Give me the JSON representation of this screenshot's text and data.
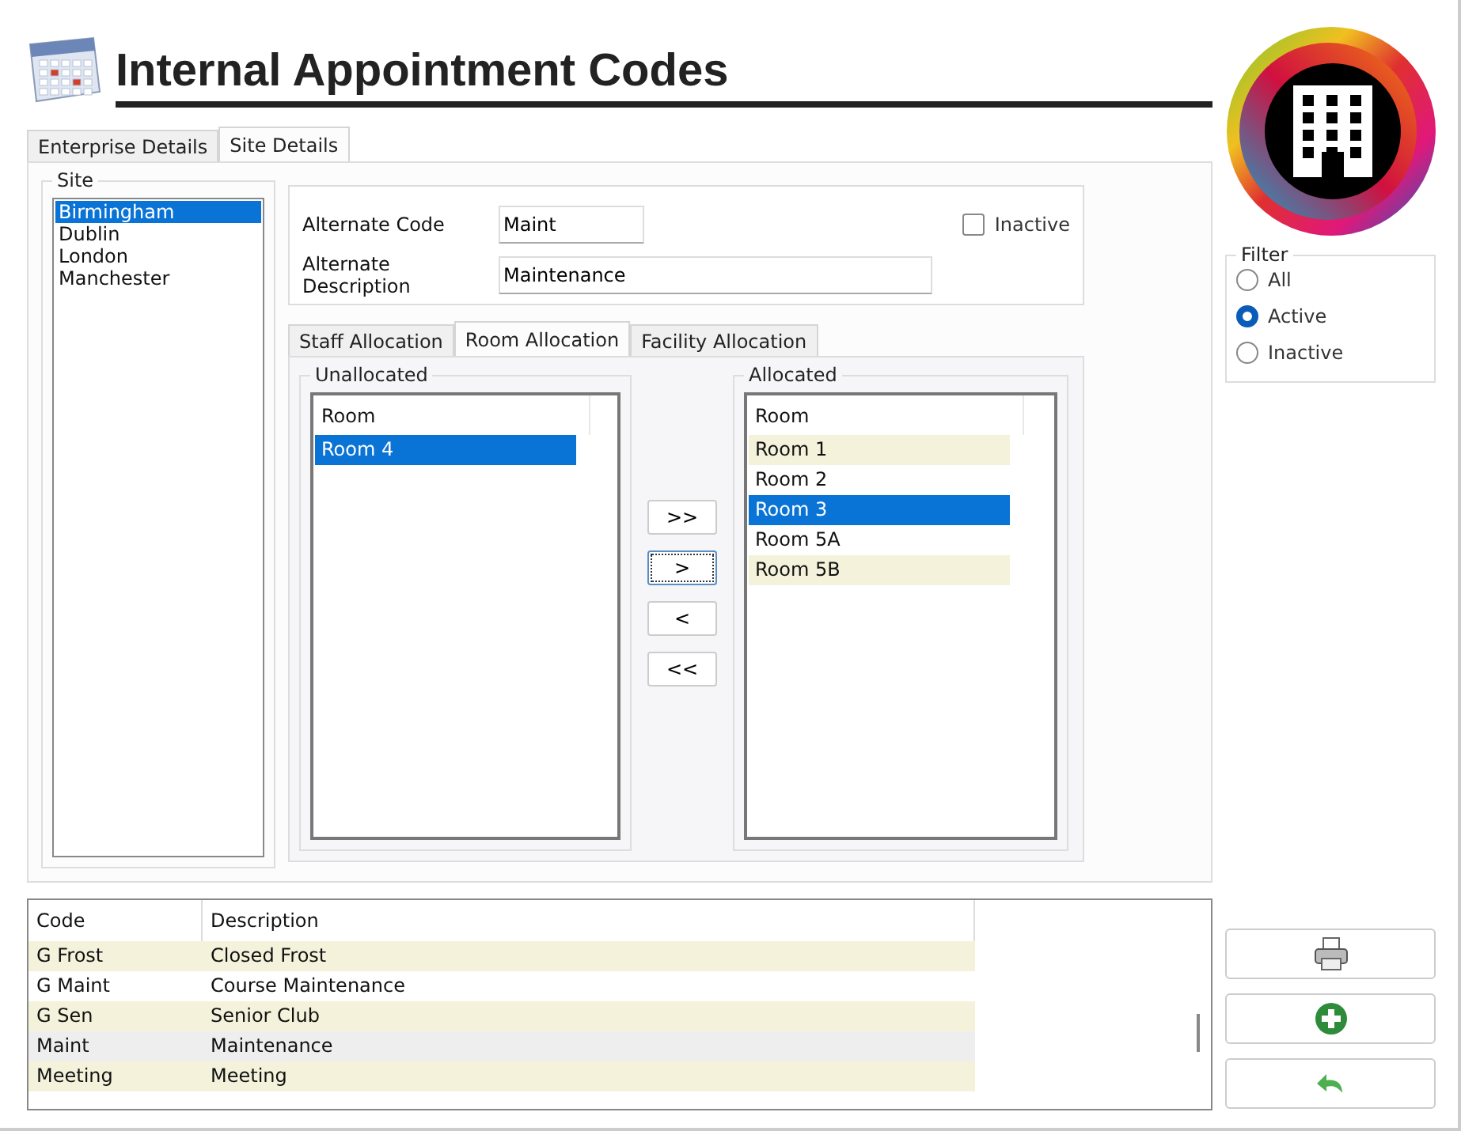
{
  "title": "Internal Appointment Codes",
  "tabs": [
    {
      "label": "Enterprise Details",
      "selected": false
    },
    {
      "label": "Site Details",
      "selected": true
    }
  ],
  "site": {
    "legend": "Site",
    "items": [
      {
        "label": "Birmingham",
        "selected": true
      },
      {
        "label": "Dublin",
        "selected": false
      },
      {
        "label": "London",
        "selected": false
      },
      {
        "label": "Manchester",
        "selected": false
      }
    ]
  },
  "alternate_code": {
    "label": "Alternate Code",
    "value": "Maint"
  },
  "alternate_description": {
    "label": "Alternate Description",
    "value": "Maintenance"
  },
  "inactive": {
    "label": "Inactive",
    "checked": false
  },
  "allocation_tabs": [
    {
      "label": "Staff Allocation",
      "selected": false
    },
    {
      "label": "Room Allocation",
      "selected": true
    },
    {
      "label": "Facility Allocation",
      "selected": false
    }
  ],
  "unallocated": {
    "legend": "Unallocated",
    "column": "Room",
    "rows": [
      {
        "label": "Room 4",
        "selected": true
      }
    ]
  },
  "move_buttons": [
    {
      "label": ">>",
      "focused": false
    },
    {
      "label": ">",
      "focused": true
    },
    {
      "label": "<",
      "focused": false
    },
    {
      "label": "<<",
      "focused": false
    }
  ],
  "allocated": {
    "legend": "Allocated",
    "column": "Room",
    "rows": [
      {
        "label": "Room 1",
        "selected": false
      },
      {
        "label": "Room 2",
        "selected": false
      },
      {
        "label": "Room 3",
        "selected": true
      },
      {
        "label": "Room 5A",
        "selected": false
      },
      {
        "label": "Room 5B",
        "selected": false
      }
    ]
  },
  "filter": {
    "legend": "Filter",
    "options": [
      {
        "label": "All",
        "selected": false
      },
      {
        "label": "Active",
        "selected": true
      },
      {
        "label": "Inactive",
        "selected": false
      }
    ]
  },
  "table": {
    "columns": [
      "Code",
      "Description"
    ],
    "rows": [
      {
        "cells": [
          "G Frost",
          "Closed Frost"
        ],
        "selected": false
      },
      {
        "cells": [
          "G Maint",
          "Course Maintenance"
        ],
        "selected": false
      },
      {
        "cells": [
          "G Sen",
          "Senior Club"
        ],
        "selected": false
      },
      {
        "cells": [
          "Maint",
          "Maintenance"
        ],
        "selected": true
      },
      {
        "cells": [
          "Meeting",
          "Meeting"
        ],
        "selected": false
      }
    ]
  },
  "action_buttons": [
    {
      "kind": "print"
    },
    {
      "kind": "add"
    },
    {
      "kind": "undo"
    }
  ]
}
